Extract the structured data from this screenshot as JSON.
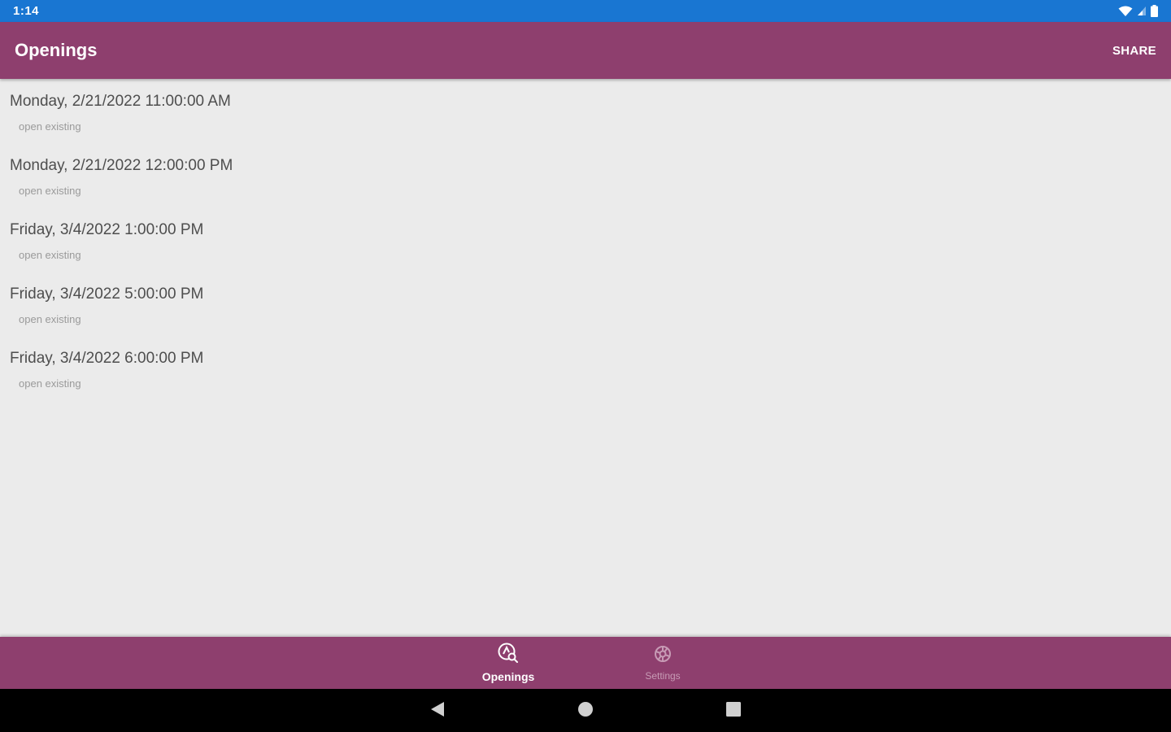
{
  "status_bar": {
    "time": "1:14",
    "icons": [
      "wifi-icon",
      "cellular-signal-icon",
      "battery-icon"
    ]
  },
  "app_bar": {
    "title": "Openings",
    "share_label": "SHARE"
  },
  "openings": [
    {
      "datetime": "Monday, 2/21/2022 11:00:00 AM",
      "status": "open existing"
    },
    {
      "datetime": "Monday, 2/21/2022 12:00:00 PM",
      "status": "open existing"
    },
    {
      "datetime": "Friday, 3/4/2022 1:00:00 PM",
      "status": "open existing"
    },
    {
      "datetime": "Friday, 3/4/2022 5:00:00 PM",
      "status": "open existing"
    },
    {
      "datetime": "Friday, 3/4/2022 6:00:00 PM",
      "status": "open existing"
    }
  ],
  "bottom_nav": {
    "tabs": [
      {
        "label": "Openings",
        "icon": "calendar-search-icon",
        "active": true
      },
      {
        "label": "Settings",
        "icon": "gear-icon",
        "active": false
      }
    ]
  },
  "system_nav": {
    "icons": [
      "back-icon",
      "home-icon",
      "recents-icon"
    ]
  },
  "colors": {
    "status_bar": "#1976d2",
    "primary": "#8e3f6e",
    "background": "#ebebeb",
    "system_nav": "#000000"
  }
}
